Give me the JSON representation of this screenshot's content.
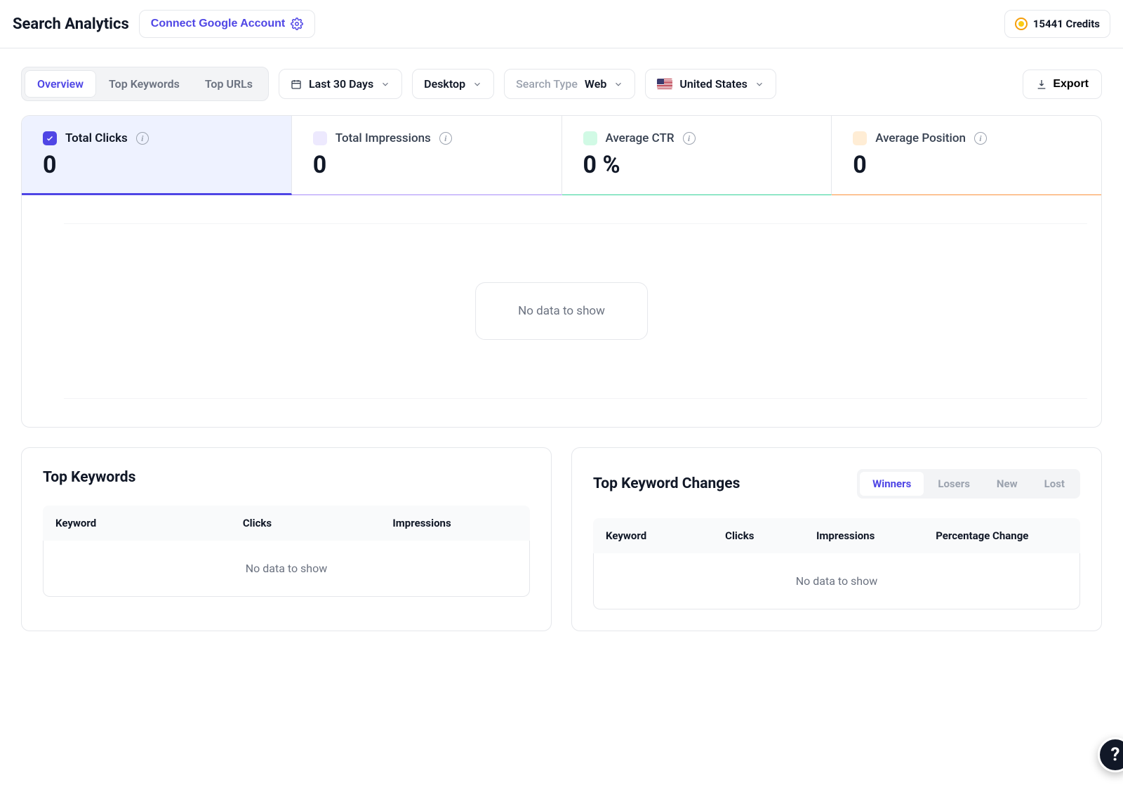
{
  "header": {
    "title": "Search Analytics",
    "connect_label": "Connect Google Account",
    "credits_value": "15441 Credits"
  },
  "tabs": {
    "overview": "Overview",
    "top_keywords": "Top Keywords",
    "top_urls": "Top URLs"
  },
  "filters": {
    "date_label": "Last 30 Days",
    "device_label": "Desktop",
    "search_type_prefix": "Search Type",
    "search_type_value": "Web",
    "country_label": "United States",
    "export_label": "Export"
  },
  "metrics": {
    "clicks": {
      "label": "Total Clicks",
      "value": "0"
    },
    "impressions": {
      "label": "Total Impressions",
      "value": "0"
    },
    "ctr": {
      "label": "Average CTR",
      "value": "0 %"
    },
    "position": {
      "label": "Average Position",
      "value": "0"
    }
  },
  "chart": {
    "no_data": "No data to show"
  },
  "top_keywords_panel": {
    "title": "Top Keywords",
    "columns": {
      "keyword": "Keyword",
      "clicks": "Clicks",
      "impressions": "Impressions"
    },
    "no_data": "No data to show"
  },
  "changes_panel": {
    "title": "Top Keyword Changes",
    "tabs": {
      "winners": "Winners",
      "losers": "Losers",
      "new": "New",
      "lost": "Lost"
    },
    "columns": {
      "keyword": "Keyword",
      "clicks": "Clicks",
      "impressions": "Impressions",
      "pct": "Percentage Change"
    },
    "no_data": "No data to show"
  },
  "help": "?"
}
